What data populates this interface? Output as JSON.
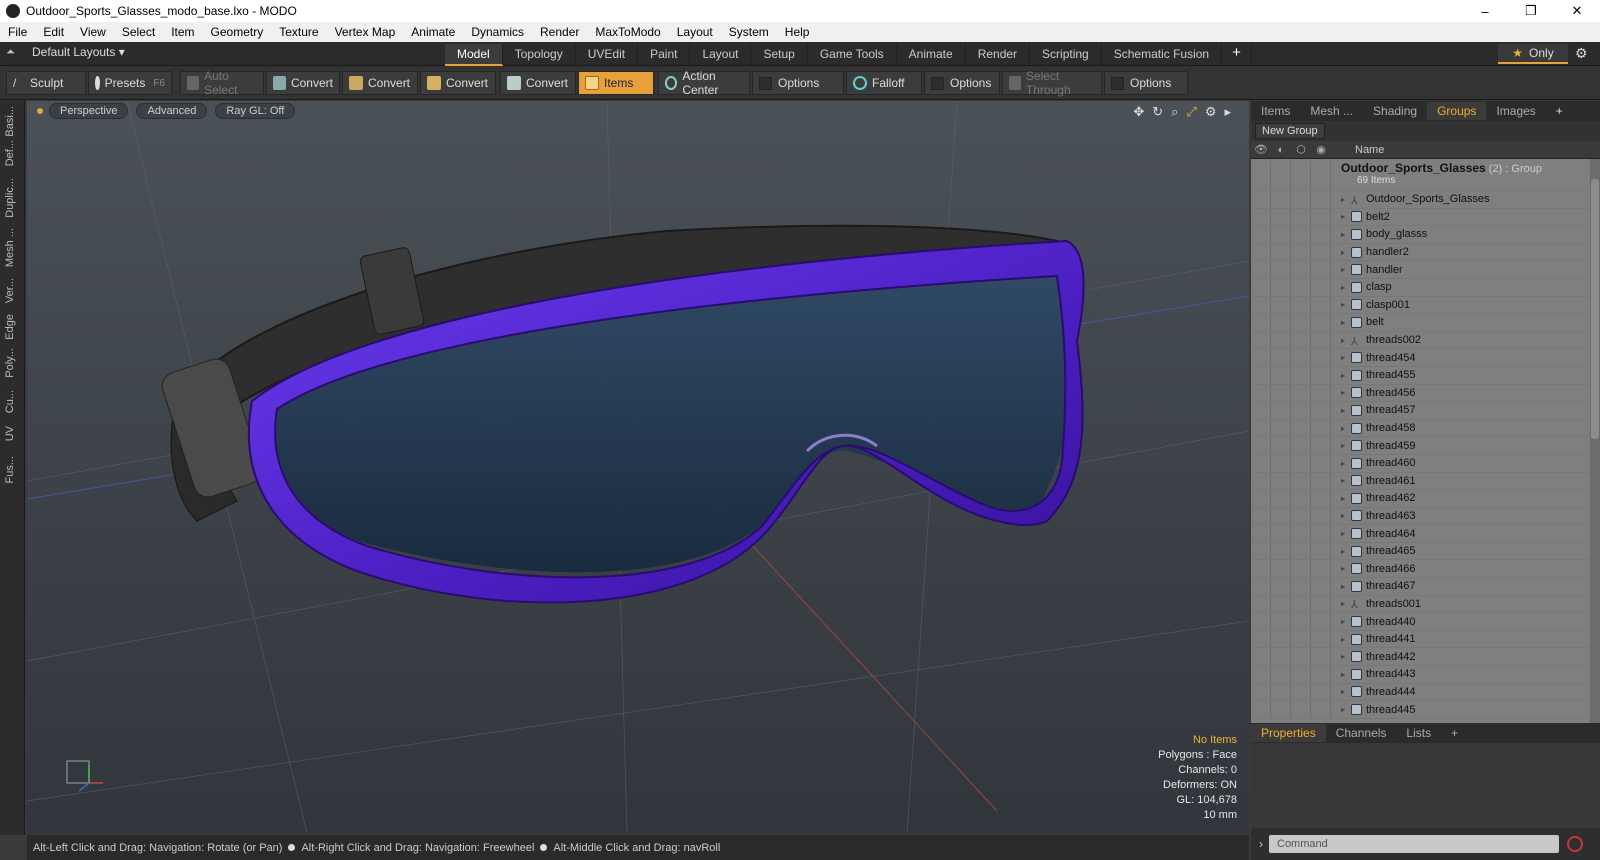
{
  "window": {
    "title": "Outdoor_Sports_Glasses_modo_base.lxo - MODO",
    "minimize": "–",
    "restore": "❐",
    "close": "✕"
  },
  "menu": [
    "File",
    "Edit",
    "View",
    "Select",
    "Item",
    "Geometry",
    "Texture",
    "Vertex Map",
    "Animate",
    "Dynamics",
    "Render",
    "MaxToModo",
    "Layout",
    "System",
    "Help"
  ],
  "layoutbar": {
    "layouts_label": "Default Layouts ▾",
    "tabs": [
      "Model",
      "Topology",
      "UVEdit",
      "Paint",
      "Layout",
      "Setup",
      "Game Tools",
      "Animate",
      "Render",
      "Scripting",
      "Schematic Fusion"
    ],
    "active_tab": "Model",
    "add": "+",
    "only_label": "Only"
  },
  "toolbar": {
    "sculpt": "Sculpt",
    "presets": "Presets",
    "presets_key": "F6",
    "auto_select": "Auto Select",
    "convert": "Convert",
    "items": "Items",
    "action_center": "Action Center",
    "options": "Options",
    "falloff": "Falloff",
    "select_through": "Select Through"
  },
  "left_strip": [
    "Basi...",
    "Def...",
    "Duplic...",
    "Mesh ...",
    "Ver...",
    "Edge",
    "Poly...",
    "Cu...",
    "UV",
    "Fus..."
  ],
  "viewport": {
    "view_mode": "Perspective",
    "shading": "Advanced",
    "raygl": "Ray GL: Off",
    "info": {
      "no_items": "No Items",
      "polygons": "Polygons : Face",
      "channels": "Channels: 0",
      "deformers": "Deformers: ON",
      "gl": "GL: 104,678",
      "scale": "10 mm"
    }
  },
  "status": {
    "hint1": "Alt-Left Click and Drag: Navigation: Rotate (or Pan)",
    "hint2": "Alt-Right Click and Drag: Navigation: Freewheel",
    "hint3": "Alt-Middle Click and Drag: navRoll"
  },
  "right_panel": {
    "tabs": [
      "Items",
      "Mesh ...",
      "Shading",
      "Groups",
      "Images"
    ],
    "active_tab": "Groups",
    "new_group": "New Group",
    "name_header": "Name",
    "group": {
      "name": "Outdoor_Sports_Glasses",
      "count": "(2)",
      "type": ": Group",
      "items": "69 Items"
    },
    "items": [
      {
        "name": "Outdoor_Sports_Glasses",
        "kind": "locator"
      },
      {
        "name": "belt2",
        "kind": "mesh"
      },
      {
        "name": "body_glasss",
        "kind": "mesh"
      },
      {
        "name": "handler2",
        "kind": "mesh"
      },
      {
        "name": "handler",
        "kind": "mesh"
      },
      {
        "name": "clasp",
        "kind": "mesh"
      },
      {
        "name": "clasp001",
        "kind": "mesh"
      },
      {
        "name": "belt",
        "kind": "mesh"
      },
      {
        "name": "threads002",
        "kind": "locator"
      },
      {
        "name": "thread454",
        "kind": "mesh"
      },
      {
        "name": "thread455",
        "kind": "mesh"
      },
      {
        "name": "thread456",
        "kind": "mesh"
      },
      {
        "name": "thread457",
        "kind": "mesh"
      },
      {
        "name": "thread458",
        "kind": "mesh"
      },
      {
        "name": "thread459",
        "kind": "mesh"
      },
      {
        "name": "thread460",
        "kind": "mesh"
      },
      {
        "name": "thread461",
        "kind": "mesh"
      },
      {
        "name": "thread462",
        "kind": "mesh"
      },
      {
        "name": "thread463",
        "kind": "mesh"
      },
      {
        "name": "thread464",
        "kind": "mesh"
      },
      {
        "name": "thread465",
        "kind": "mesh"
      },
      {
        "name": "thread466",
        "kind": "mesh"
      },
      {
        "name": "thread467",
        "kind": "mesh"
      },
      {
        "name": "threads001",
        "kind": "locator"
      },
      {
        "name": "thread440",
        "kind": "mesh"
      },
      {
        "name": "thread441",
        "kind": "mesh"
      },
      {
        "name": "thread442",
        "kind": "mesh"
      },
      {
        "name": "thread443",
        "kind": "mesh"
      },
      {
        "name": "thread444",
        "kind": "mesh"
      },
      {
        "name": "thread445",
        "kind": "mesh"
      }
    ],
    "bottom_tabs": [
      "Properties",
      "Channels",
      "Lists"
    ],
    "bottom_active": "Properties",
    "command_placeholder": "Command"
  }
}
